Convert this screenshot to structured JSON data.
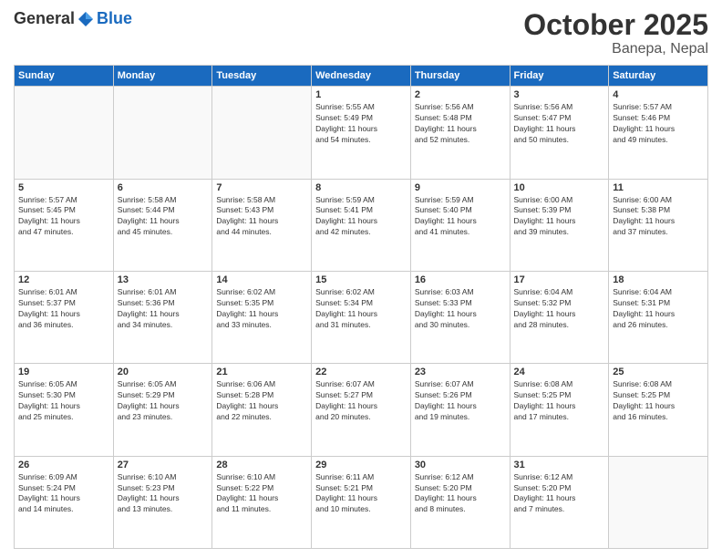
{
  "header": {
    "logo": {
      "general": "General",
      "blue": "Blue"
    },
    "title": "October 2025",
    "subtitle": "Banepa, Nepal"
  },
  "weekdays": [
    "Sunday",
    "Monday",
    "Tuesday",
    "Wednesday",
    "Thursday",
    "Friday",
    "Saturday"
  ],
  "weeks": [
    [
      {
        "day": "",
        "info": ""
      },
      {
        "day": "",
        "info": ""
      },
      {
        "day": "",
        "info": ""
      },
      {
        "day": "1",
        "info": "Sunrise: 5:55 AM\nSunset: 5:49 PM\nDaylight: 11 hours\nand 54 minutes."
      },
      {
        "day": "2",
        "info": "Sunrise: 5:56 AM\nSunset: 5:48 PM\nDaylight: 11 hours\nand 52 minutes."
      },
      {
        "day": "3",
        "info": "Sunrise: 5:56 AM\nSunset: 5:47 PM\nDaylight: 11 hours\nand 50 minutes."
      },
      {
        "day": "4",
        "info": "Sunrise: 5:57 AM\nSunset: 5:46 PM\nDaylight: 11 hours\nand 49 minutes."
      }
    ],
    [
      {
        "day": "5",
        "info": "Sunrise: 5:57 AM\nSunset: 5:45 PM\nDaylight: 11 hours\nand 47 minutes."
      },
      {
        "day": "6",
        "info": "Sunrise: 5:58 AM\nSunset: 5:44 PM\nDaylight: 11 hours\nand 45 minutes."
      },
      {
        "day": "7",
        "info": "Sunrise: 5:58 AM\nSunset: 5:43 PM\nDaylight: 11 hours\nand 44 minutes."
      },
      {
        "day": "8",
        "info": "Sunrise: 5:59 AM\nSunset: 5:41 PM\nDaylight: 11 hours\nand 42 minutes."
      },
      {
        "day": "9",
        "info": "Sunrise: 5:59 AM\nSunset: 5:40 PM\nDaylight: 11 hours\nand 41 minutes."
      },
      {
        "day": "10",
        "info": "Sunrise: 6:00 AM\nSunset: 5:39 PM\nDaylight: 11 hours\nand 39 minutes."
      },
      {
        "day": "11",
        "info": "Sunrise: 6:00 AM\nSunset: 5:38 PM\nDaylight: 11 hours\nand 37 minutes."
      }
    ],
    [
      {
        "day": "12",
        "info": "Sunrise: 6:01 AM\nSunset: 5:37 PM\nDaylight: 11 hours\nand 36 minutes."
      },
      {
        "day": "13",
        "info": "Sunrise: 6:01 AM\nSunset: 5:36 PM\nDaylight: 11 hours\nand 34 minutes."
      },
      {
        "day": "14",
        "info": "Sunrise: 6:02 AM\nSunset: 5:35 PM\nDaylight: 11 hours\nand 33 minutes."
      },
      {
        "day": "15",
        "info": "Sunrise: 6:02 AM\nSunset: 5:34 PM\nDaylight: 11 hours\nand 31 minutes."
      },
      {
        "day": "16",
        "info": "Sunrise: 6:03 AM\nSunset: 5:33 PM\nDaylight: 11 hours\nand 30 minutes."
      },
      {
        "day": "17",
        "info": "Sunrise: 6:04 AM\nSunset: 5:32 PM\nDaylight: 11 hours\nand 28 minutes."
      },
      {
        "day": "18",
        "info": "Sunrise: 6:04 AM\nSunset: 5:31 PM\nDaylight: 11 hours\nand 26 minutes."
      }
    ],
    [
      {
        "day": "19",
        "info": "Sunrise: 6:05 AM\nSunset: 5:30 PM\nDaylight: 11 hours\nand 25 minutes."
      },
      {
        "day": "20",
        "info": "Sunrise: 6:05 AM\nSunset: 5:29 PM\nDaylight: 11 hours\nand 23 minutes."
      },
      {
        "day": "21",
        "info": "Sunrise: 6:06 AM\nSunset: 5:28 PM\nDaylight: 11 hours\nand 22 minutes."
      },
      {
        "day": "22",
        "info": "Sunrise: 6:07 AM\nSunset: 5:27 PM\nDaylight: 11 hours\nand 20 minutes."
      },
      {
        "day": "23",
        "info": "Sunrise: 6:07 AM\nSunset: 5:26 PM\nDaylight: 11 hours\nand 19 minutes."
      },
      {
        "day": "24",
        "info": "Sunrise: 6:08 AM\nSunset: 5:25 PM\nDaylight: 11 hours\nand 17 minutes."
      },
      {
        "day": "25",
        "info": "Sunrise: 6:08 AM\nSunset: 5:25 PM\nDaylight: 11 hours\nand 16 minutes."
      }
    ],
    [
      {
        "day": "26",
        "info": "Sunrise: 6:09 AM\nSunset: 5:24 PM\nDaylight: 11 hours\nand 14 minutes."
      },
      {
        "day": "27",
        "info": "Sunrise: 6:10 AM\nSunset: 5:23 PM\nDaylight: 11 hours\nand 13 minutes."
      },
      {
        "day": "28",
        "info": "Sunrise: 6:10 AM\nSunset: 5:22 PM\nDaylight: 11 hours\nand 11 minutes."
      },
      {
        "day": "29",
        "info": "Sunrise: 6:11 AM\nSunset: 5:21 PM\nDaylight: 11 hours\nand 10 minutes."
      },
      {
        "day": "30",
        "info": "Sunrise: 6:12 AM\nSunset: 5:20 PM\nDaylight: 11 hours\nand 8 minutes."
      },
      {
        "day": "31",
        "info": "Sunrise: 6:12 AM\nSunset: 5:20 PM\nDaylight: 11 hours\nand 7 minutes."
      },
      {
        "day": "",
        "info": ""
      }
    ]
  ]
}
